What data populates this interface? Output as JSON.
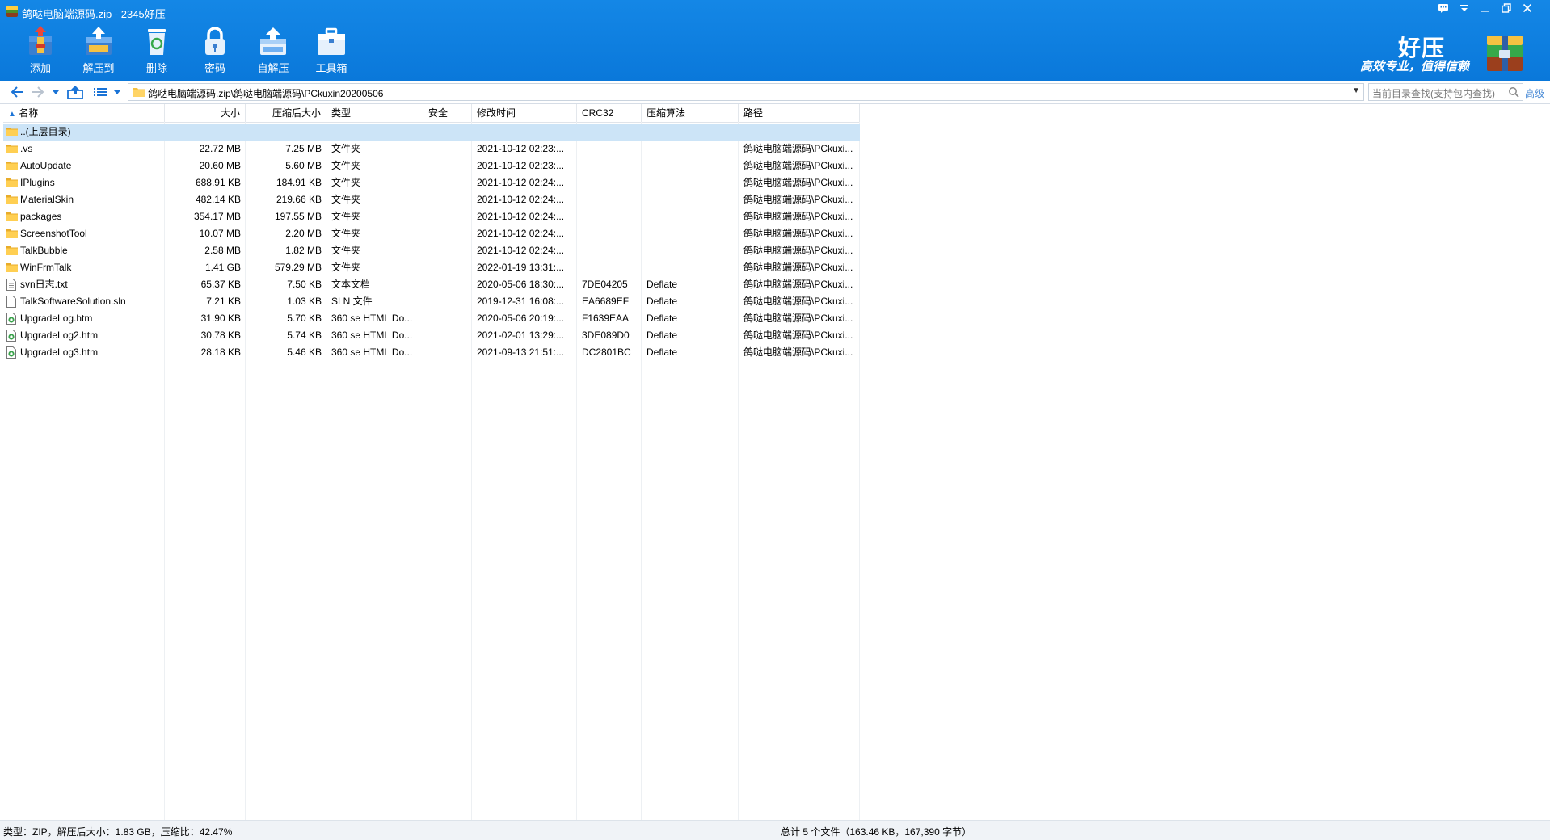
{
  "window": {
    "title": "鸽哒电脑端源码.zip - 2345好压",
    "controls": [
      "feedback-icon",
      "menu-icon",
      "minimize-icon",
      "restore-icon",
      "close-icon"
    ]
  },
  "toolbar": {
    "items": [
      {
        "label": "添加",
        "icon": "add-archive-icon"
      },
      {
        "label": "解压到",
        "icon": "extract-to-icon"
      },
      {
        "label": "删除",
        "icon": "delete-icon"
      },
      {
        "label": "密码",
        "icon": "password-lock-icon"
      },
      {
        "label": "自解压",
        "icon": "self-extract-icon"
      },
      {
        "label": "工具箱",
        "icon": "toolbox-icon"
      }
    ]
  },
  "brand": {
    "title": "好压",
    "slogan": "高效专业，值得信赖"
  },
  "address": {
    "path": "鸽哒电脑端源码.zip\\鸽哒电脑端源码\\PCkuxin20200506"
  },
  "search": {
    "placeholder": "当前目录查找(支持包内查找)",
    "advanced_label": "高级"
  },
  "columns": {
    "name": "名称",
    "size": "大小",
    "packed": "压缩后大小",
    "type": "类型",
    "security": "安全",
    "modified": "修改时间",
    "crc": "CRC32",
    "method": "压缩算法",
    "path": "路径"
  },
  "files": [
    {
      "name": "..(上层目录)",
      "size": "",
      "packed": "",
      "type": "",
      "security": "",
      "modified": "",
      "crc": "",
      "method": "",
      "path": "",
      "kind": "folder",
      "selected": true
    },
    {
      "name": ".vs",
      "size": "22.72 MB",
      "packed": "7.25 MB",
      "type": "文件夹",
      "security": "",
      "modified": "2021-10-12 02:23:...",
      "crc": "",
      "method": "",
      "path": "鸽哒电脑端源码\\PCkuxi...",
      "kind": "folder"
    },
    {
      "name": "AutoUpdate",
      "size": "20.60 MB",
      "packed": "5.60 MB",
      "type": "文件夹",
      "security": "",
      "modified": "2021-10-12 02:23:...",
      "crc": "",
      "method": "",
      "path": "鸽哒电脑端源码\\PCkuxi...",
      "kind": "folder"
    },
    {
      "name": "IPlugins",
      "size": "688.91 KB",
      "packed": "184.91 KB",
      "type": "文件夹",
      "security": "",
      "modified": "2021-10-12 02:24:...",
      "crc": "",
      "method": "",
      "path": "鸽哒电脑端源码\\PCkuxi...",
      "kind": "folder"
    },
    {
      "name": "MaterialSkin",
      "size": "482.14 KB",
      "packed": "219.66 KB",
      "type": "文件夹",
      "security": "",
      "modified": "2021-10-12 02:24:...",
      "crc": "",
      "method": "",
      "path": "鸽哒电脑端源码\\PCkuxi...",
      "kind": "folder"
    },
    {
      "name": "packages",
      "size": "354.17 MB",
      "packed": "197.55 MB",
      "type": "文件夹",
      "security": "",
      "modified": "2021-10-12 02:24:...",
      "crc": "",
      "method": "",
      "path": "鸽哒电脑端源码\\PCkuxi...",
      "kind": "folder"
    },
    {
      "name": "ScreenshotTool",
      "size": "10.07 MB",
      "packed": "2.20 MB",
      "type": "文件夹",
      "security": "",
      "modified": "2021-10-12 02:24:...",
      "crc": "",
      "method": "",
      "path": "鸽哒电脑端源码\\PCkuxi...",
      "kind": "folder"
    },
    {
      "name": "TalkBubble",
      "size": "2.58 MB",
      "packed": "1.82 MB",
      "type": "文件夹",
      "security": "",
      "modified": "2021-10-12 02:24:...",
      "crc": "",
      "method": "",
      "path": "鸽哒电脑端源码\\PCkuxi...",
      "kind": "folder"
    },
    {
      "name": "WinFrmTalk",
      "size": "1.41 GB",
      "packed": "579.29 MB",
      "type": "文件夹",
      "security": "",
      "modified": "2022-01-19 13:31:...",
      "crc": "",
      "method": "",
      "path": "鸽哒电脑端源码\\PCkuxi...",
      "kind": "folder"
    },
    {
      "name": "svn日志.txt",
      "size": "65.37 KB",
      "packed": "7.50 KB",
      "type": "文本文档",
      "security": "",
      "modified": "2020-05-06 18:30:...",
      "crc": "7DE04205",
      "method": "Deflate",
      "path": "鸽哒电脑端源码\\PCkuxi...",
      "kind": "text"
    },
    {
      "name": "TalkSoftwareSolution.sln",
      "size": "7.21 KB",
      "packed": "1.03 KB",
      "type": "SLN 文件",
      "security": "",
      "modified": "2019-12-31 16:08:...",
      "crc": "EA6689EF",
      "method": "Deflate",
      "path": "鸽哒电脑端源码\\PCkuxi...",
      "kind": "file"
    },
    {
      "name": "UpgradeLog.htm",
      "size": "31.90 KB",
      "packed": "5.70 KB",
      "type": "360 se HTML Do...",
      "security": "",
      "modified": "2020-05-06 20:19:...",
      "crc": "F1639EAA",
      "method": "Deflate",
      "path": "鸽哒电脑端源码\\PCkuxi...",
      "kind": "html"
    },
    {
      "name": "UpgradeLog2.htm",
      "size": "30.78 KB",
      "packed": "5.74 KB",
      "type": "360 se HTML Do...",
      "security": "",
      "modified": "2021-02-01 13:29:...",
      "crc": "3DE089D0",
      "method": "Deflate",
      "path": "鸽哒电脑端源码\\PCkuxi...",
      "kind": "html"
    },
    {
      "name": "UpgradeLog3.htm",
      "size": "28.18 KB",
      "packed": "5.46 KB",
      "type": "360 se HTML Do...",
      "security": "",
      "modified": "2021-09-13 21:51:...",
      "crc": "DC2801BC",
      "method": "Deflate",
      "path": "鸽哒电脑端源码\\PCkuxi...",
      "kind": "html"
    }
  ],
  "status": {
    "left": "类型：ZIP，解压后大小：1.83 GB，压缩比：42.47%",
    "right": "总计 5 个文件（163.46 KB，167,390 字节）"
  },
  "colors": {
    "toolbar_blue": "#0d7fe0",
    "selected_row": "#cce4f7",
    "folder_yellow": "#f5c242",
    "link_blue": "#4a8bd6"
  }
}
